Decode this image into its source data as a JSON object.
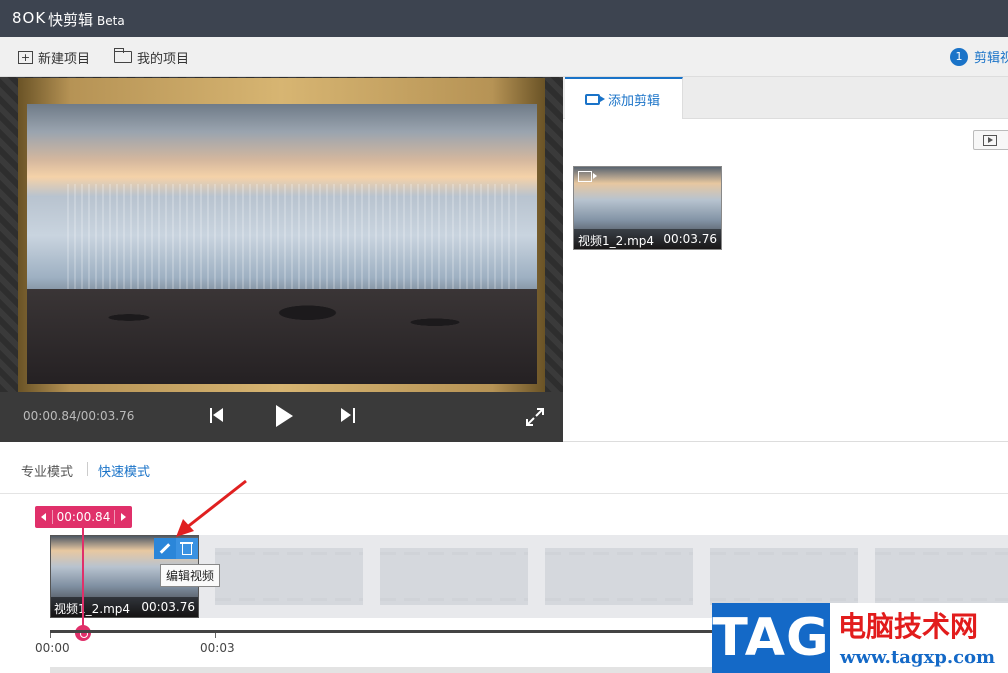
{
  "titlebar": {
    "logo": "8OK",
    "app_name": "快剪辑",
    "badge": "Beta"
  },
  "toolbar": {
    "new_project": "新建项目",
    "my_projects": "我的项目",
    "step_number": "1",
    "step_label": "剪辑视"
  },
  "player": {
    "time_readout": "00:00.84/00:03.76"
  },
  "media_panel": {
    "tab_label": "添加剪辑",
    "items": [
      {
        "name": "视频1_2.mp4",
        "duration": "00:03.76"
      }
    ]
  },
  "modes": {
    "pro": "专业模式",
    "fast": "快速模式"
  },
  "timeline": {
    "playhead_time": "00:00.84",
    "clip": {
      "name": "视频1_2.mp4",
      "duration": "00:03.76"
    },
    "tooltip": "编辑视频",
    "ticks": [
      "00:00",
      "00:03"
    ]
  },
  "watermark": {
    "tag": "TAG",
    "title": "电脑技术网",
    "url": "www.tagxp.com"
  },
  "colors": {
    "accent": "#1a73c8",
    "playhead": "#e0306a",
    "titlebar": "#3d4450"
  }
}
